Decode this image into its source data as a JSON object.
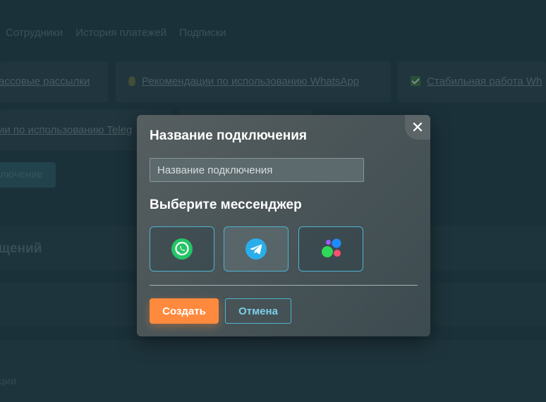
{
  "background": {
    "nav": [
      "Сотрудники",
      "История платежей",
      "Подписки"
    ],
    "cards_row1": [
      {
        "text": "ассовые рассылки"
      },
      {
        "text": "Рекомендации по использованию WhatsApp",
        "icon": "lightbulb-icon"
      },
      {
        "text": "Стабильная работа Wh",
        "icon": "check-icon"
      }
    ],
    "cards_row2": [
      {
        "text": "ии по использованию Teleg"
      }
    ],
    "create_button_fragment": "ключение",
    "section_title": "щений",
    "section_fragment": "",
    "bottom_text": "ции"
  },
  "modal": {
    "title": "Название подключения",
    "input": {
      "placeholder": "Название подключения",
      "value": ""
    },
    "messenger_heading": "Выберите мессенджер",
    "messengers": [
      {
        "name": "WhatsApp",
        "icon": "whatsapp-icon",
        "color": "#25c466",
        "selected": false
      },
      {
        "name": "Telegram",
        "icon": "telegram-icon",
        "color": "#2aaeea",
        "selected": true
      },
      {
        "name": "Other",
        "icon": "dots-messenger-icon",
        "selected": false
      }
    ],
    "create_label": "Создать",
    "cancel_label": "Отмена",
    "close_symbol": "✕"
  },
  "colors": {
    "accent_orange": "#ff8a3d",
    "accent_blue": "#4fb4cf",
    "page_bg": "#223a42"
  }
}
